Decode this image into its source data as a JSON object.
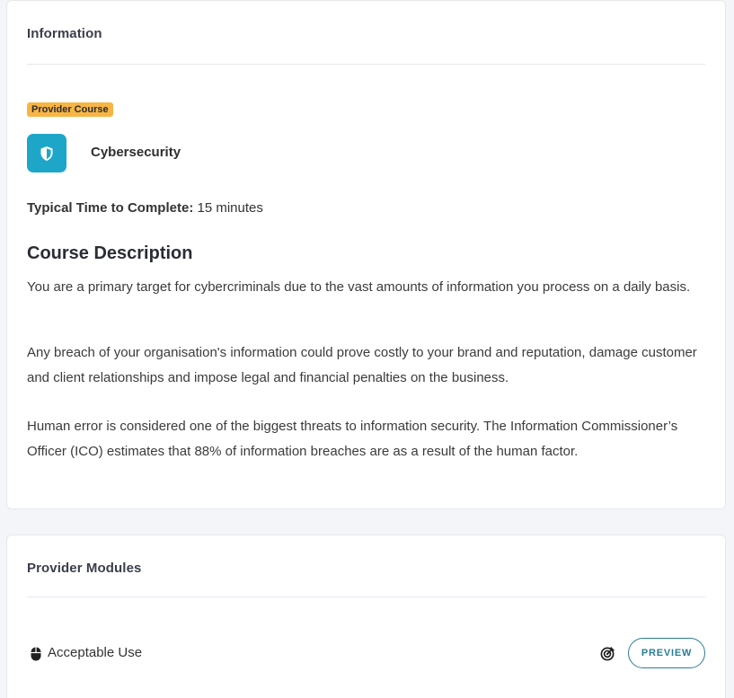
{
  "information": {
    "title": "Information",
    "badge": "Provider Course",
    "course_icon": "shield-icon",
    "course_icon_color": "#1ea6c9",
    "course_name": "Cybersecurity",
    "time_label": "Typical Time to Complete:",
    "time_value": "15 minutes",
    "description_heading": "Course Description",
    "paragraphs": [
      "You are a primary target for cybercriminals due to the vast amounts of information you process on a daily basis.",
      "Any breach of your organisation's information could prove costly to your brand and reputation, damage customer and client relationships and impose legal and financial penalties on the business.",
      "Human error is considered one of the biggest threats to information security. The Information Commissioner’s Officer (ICO) estimates that 88% of information breaches are as a result of the human factor."
    ]
  },
  "modules": {
    "title": "Provider Modules",
    "items": [
      {
        "icon": "mouse-icon",
        "name": "Acceptable Use",
        "status_icon": "target-icon",
        "action_label": "PREVIEW"
      }
    ]
  },
  "colors": {
    "badge": "#f7b544",
    "accent": "#2c7c95",
    "background": "#f4f5f9"
  }
}
